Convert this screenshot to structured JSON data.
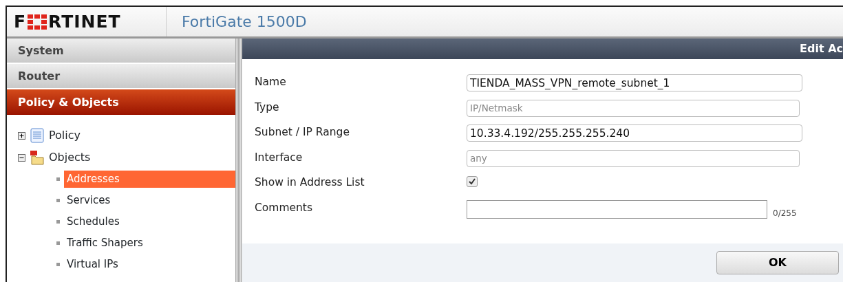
{
  "header": {
    "logo_left": "F",
    "logo_right": "RTINET",
    "product": "FortiGate 1500D"
  },
  "sidebar": {
    "sections": [
      {
        "label": "System",
        "selected": false
      },
      {
        "label": "Router",
        "selected": false
      },
      {
        "label": "Policy & Objects",
        "selected": true
      }
    ],
    "tree": [
      {
        "label": "Policy",
        "expanded": false,
        "selected": false
      },
      {
        "label": "Objects",
        "expanded": true,
        "selected": false,
        "children": [
          {
            "label": "Addresses",
            "selected": true
          },
          {
            "label": "Services",
            "selected": false
          },
          {
            "label": "Schedules",
            "selected": false
          },
          {
            "label": "Traffic Shapers",
            "selected": false
          },
          {
            "label": "Virtual IPs",
            "selected": false
          }
        ]
      }
    ]
  },
  "dialog": {
    "title": "Edit Ac",
    "fields": [
      {
        "kind": "text",
        "label": "Name",
        "value": "TIENDA_MASS_VPN_remote_subnet_1",
        "disabled": false
      },
      {
        "kind": "text",
        "label": "Type",
        "value": "IP/Netmask",
        "disabled": true
      },
      {
        "kind": "text",
        "label": "Subnet / IP Range",
        "value": "10.33.4.192/255.255.255.240",
        "disabled": false
      },
      {
        "kind": "text",
        "label": "Interface",
        "value": "any",
        "disabled": true
      },
      {
        "kind": "checkbox",
        "label": "Show in Address List",
        "checked": true
      },
      {
        "kind": "textarea",
        "label": "Comments",
        "counter": "0/255"
      }
    ],
    "ok": "OK"
  }
}
